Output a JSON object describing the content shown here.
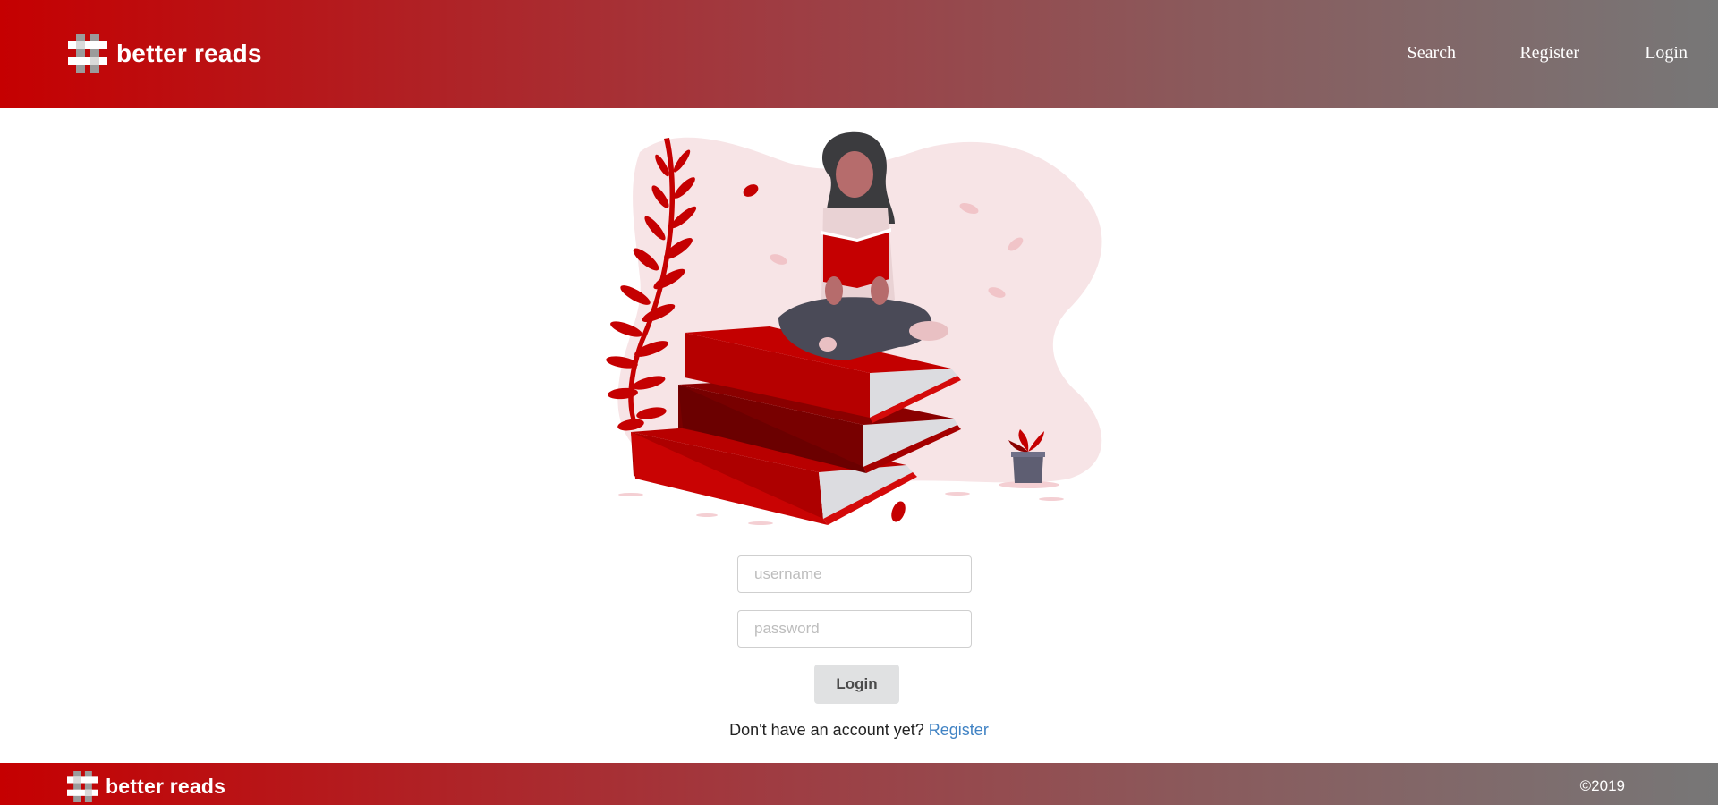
{
  "brand": {
    "name": "better reads"
  },
  "nav": {
    "items": [
      "Search",
      "Register",
      "Login"
    ]
  },
  "form": {
    "username_placeholder": "username",
    "password_placeholder": "password",
    "login_label": "Login",
    "prompt_text": "Don't have an account yet?",
    "register_link": "Register"
  },
  "footer": {
    "brand": "better reads",
    "copyright": "©2019"
  },
  "colors": {
    "primary": "#c50001",
    "gradient_end": "#777777",
    "link": "#4183c4",
    "button_bg": "#e0e1e2"
  }
}
